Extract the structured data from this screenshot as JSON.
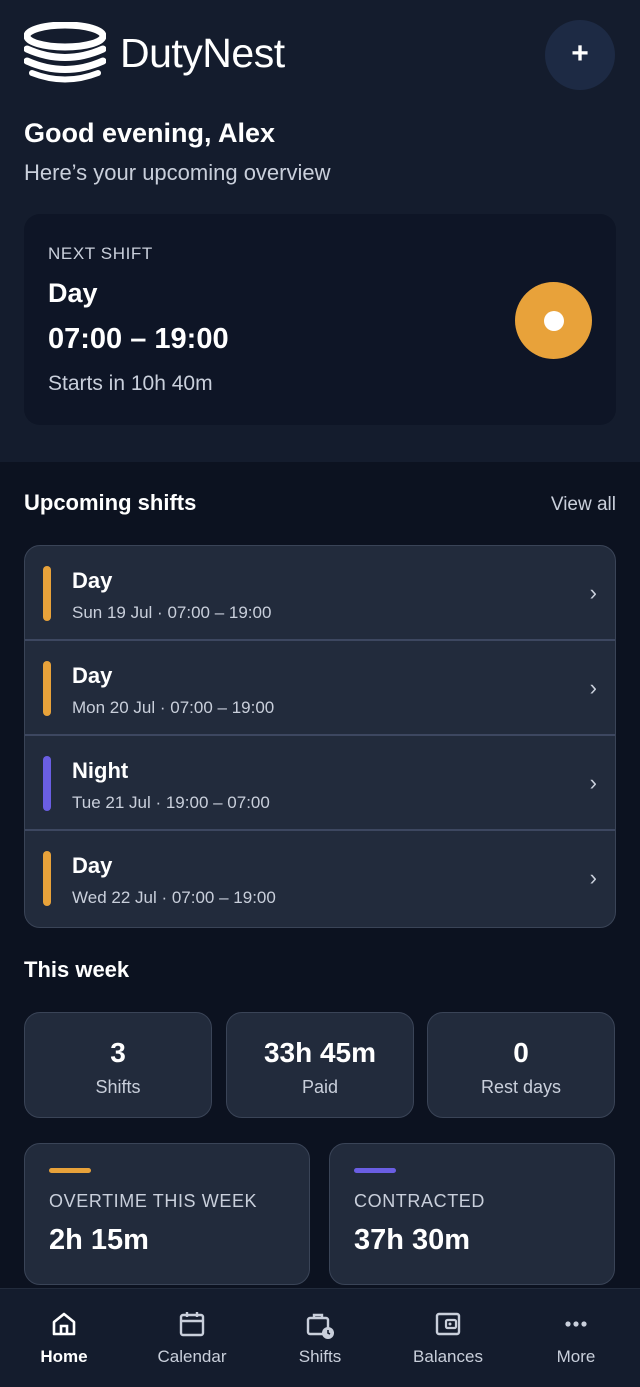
{
  "app": {
    "name": "DutyNest",
    "add_symbol": "+"
  },
  "greeting": {
    "title": "Good evening, Alex",
    "subtitle": "Here’s your upcoming overview"
  },
  "next_shift": {
    "label": "NEXT SHIFT",
    "type": "Day",
    "time": "07:00 – 19:00",
    "starts": "Starts in 10h 40m",
    "icon": "sun-icon",
    "color": "#e8a23a"
  },
  "upcoming": {
    "title": "Upcoming shifts",
    "view_all": "View all",
    "items": [
      {
        "type": "Day",
        "when": "Sun 19 Jul · 07:00 – 19:00",
        "color": "#e8a23a"
      },
      {
        "type": "Day",
        "when": "Mon 20 Jul · 07:00 – 19:00",
        "color": "#e8a23a"
      },
      {
        "type": "Night",
        "when": "Tue 21 Jul · 19:00 – 07:00",
        "color": "#6a5ee3"
      },
      {
        "type": "Day",
        "when": "Wed 22 Jul · 07:00 – 19:00",
        "color": "#e8a23a"
      }
    ]
  },
  "week": {
    "title": "This week",
    "stats": [
      {
        "value": "3",
        "label": "Shifts"
      },
      {
        "value": "33h 45m",
        "label": "Paid"
      },
      {
        "value": "0",
        "label": "Rest days"
      }
    ],
    "overtime": {
      "label": "OVERTIME THIS WEEK",
      "value": "2h 15m",
      "color": "#e8a23a"
    },
    "contracted": {
      "label": "CONTRACTED",
      "value": "37h 30m",
      "color": "#6a5ee3"
    }
  },
  "tabs": [
    {
      "label": "Home",
      "icon": "home-icon",
      "active": true
    },
    {
      "label": "Calendar",
      "icon": "calendar-icon",
      "active": false
    },
    {
      "label": "Shifts",
      "icon": "shifts-icon",
      "active": false
    },
    {
      "label": "Balances",
      "icon": "wallet-icon",
      "active": false
    },
    {
      "label": "More",
      "icon": "more-icon",
      "active": false
    }
  ]
}
